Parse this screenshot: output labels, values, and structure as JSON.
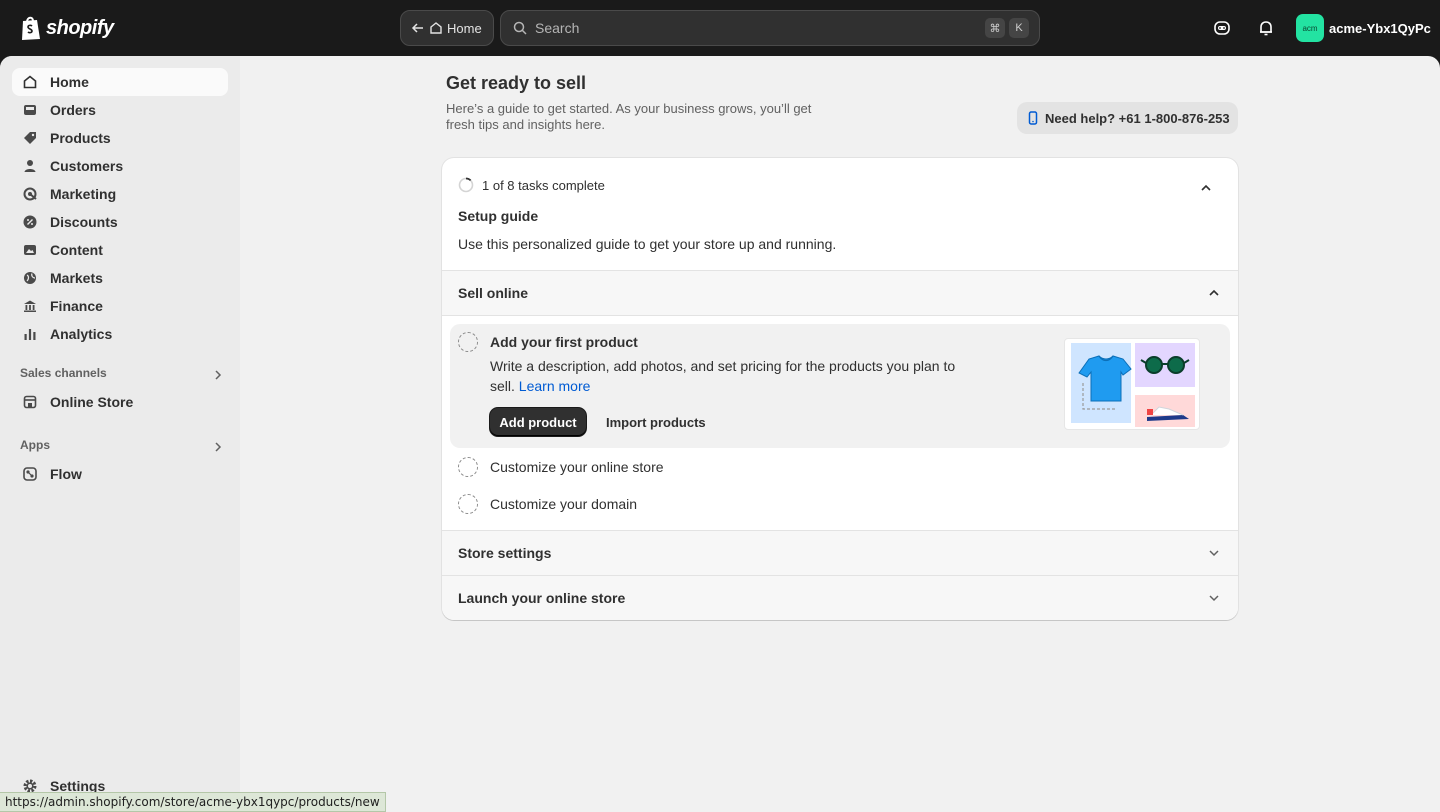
{
  "topbar": {
    "brand": "shopify",
    "home_label": "Home",
    "search_placeholder": "Search",
    "shortcut_keys": [
      "⌘",
      "K"
    ],
    "store_avatar_text": "acm",
    "store_name": "acme-Ybx1QyPc"
  },
  "sidebar": {
    "items": [
      {
        "label": "Home",
        "icon": "home-icon",
        "active": true
      },
      {
        "label": "Orders",
        "icon": "inbox-icon"
      },
      {
        "label": "Products",
        "icon": "tag-icon"
      },
      {
        "label": "Customers",
        "icon": "person-icon"
      },
      {
        "label": "Marketing",
        "icon": "target-icon"
      },
      {
        "label": "Discounts",
        "icon": "discount-icon"
      },
      {
        "label": "Content",
        "icon": "image-icon"
      },
      {
        "label": "Markets",
        "icon": "globe-icon"
      },
      {
        "label": "Finance",
        "icon": "bank-icon"
      },
      {
        "label": "Analytics",
        "icon": "bar-chart-icon"
      }
    ],
    "sales_channels_label": "Sales channels",
    "online_store_label": "Online Store",
    "apps_label": "Apps",
    "flow_label": "Flow",
    "settings_label": "Settings"
  },
  "main": {
    "title": "Get ready to sell",
    "subtitle": "Here’s a guide to get started. As your business grows, you’ll get fresh tips and insights here.",
    "help_label": "Need help? +61 1-800-876-253",
    "setup": {
      "progress_text": "1 of 8 tasks complete",
      "title": "Setup guide",
      "description": "Use this personalized guide to get your store up and running.",
      "sections": [
        {
          "label": "Sell online",
          "expanded": true
        },
        {
          "label": "Store settings",
          "expanded": false
        },
        {
          "label": "Launch your online store",
          "expanded": false
        }
      ],
      "active_task": {
        "title": "Add your first product",
        "description": "Write a description, add photos, and set pricing for the products you plan to sell.",
        "link": "Learn more",
        "primary_button": "Add product",
        "secondary_button": "Import products"
      },
      "other_tasks": [
        "Customize your online store",
        "Customize your domain"
      ]
    }
  },
  "status_bar": {
    "url": "https://admin.shopify.com/store/acme-ybx1qypc/products/new"
  },
  "colors": {
    "topbar": "#1a1a1a",
    "accent_avatar": "#23e3a2",
    "link": "#005bd3",
    "primary_button": "#303030"
  }
}
